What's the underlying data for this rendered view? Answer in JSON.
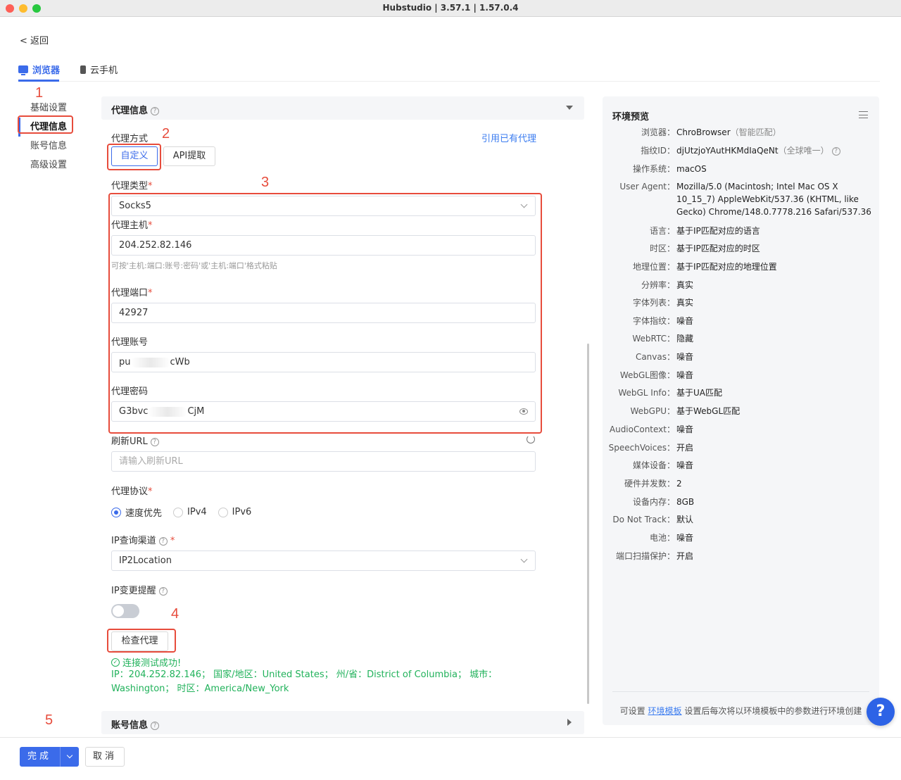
{
  "window": {
    "title": "Hubstudio | 3.57.1 | 1.57.0.4"
  },
  "nav": {
    "back": "< 返回",
    "tabs": [
      {
        "label": "浏览器",
        "icon": "browser-icon"
      },
      {
        "label": "云手机",
        "icon": "phone-icon"
      }
    ],
    "side": [
      "基础设置",
      "代理信息",
      "账号信息",
      "高级设置"
    ]
  },
  "annotations": [
    "1",
    "2",
    "3",
    "4",
    "5"
  ],
  "proxy": {
    "section_title": "代理信息",
    "mode_label": "代理方式",
    "use_existing": "引用已有代理",
    "mode_custom": "自定义",
    "mode_api": "API提取",
    "type_label": "代理类型",
    "type_value": "Socks5",
    "host_label": "代理主机",
    "host_value": "204.252.82.146",
    "host_hint": "可按'主机:端口:账号:密码'或'主机:端口'格式粘贴",
    "port_label": "代理端口",
    "port_value": "42927",
    "account_label": "代理账号",
    "account_prefix": "pu",
    "account_mid": "ibje",
    "account_suffix": "cWb",
    "password_label": "代理密码",
    "password_prefix": "G3bvc",
    "password_suffix": "CjM",
    "refresh_label": "刷新URL",
    "refresh_placeholder": "请输入刷新URL",
    "protocol_label": "代理协议",
    "protocol_options": [
      "速度优先",
      "IPv4",
      "IPv6"
    ],
    "protocol_selected": "速度优先",
    "ipquery_label": "IP查询渠道",
    "ipquery_value": "IP2Location",
    "ipchange_label": "IP变更提醒",
    "ipchange_on": false,
    "check_button": "检查代理",
    "check_result": "连接测试成功!",
    "check_detail": "IP：204.252.82.146；  国家/地区：United States；  州/省：District of Columbia；  城市：Washington；  时区：America/New_York",
    "required_mark": "*"
  },
  "account_section": {
    "title": "账号信息"
  },
  "preview": {
    "title": "环境预览",
    "items": [
      {
        "k": "浏览器：",
        "v": "ChroBrowser",
        "note": "（智能匹配）"
      },
      {
        "k": "指纹ID：",
        "v": "djUtzjoYAutHKMdIaQeNt",
        "note": "（全球唯一）"
      },
      {
        "k": "操作系统：",
        "v": "macOS"
      },
      {
        "k": "User Agent：",
        "v": "Mozilla/5.0 (Macintosh; Intel Mac OS X 10_15_7) AppleWebKit/537.36 (KHTML, like Gecko) Chrome/148.0.7778.216 Safari/537.36"
      },
      {
        "k": "语言：",
        "v": "基于IP匹配对应的语言"
      },
      {
        "k": "时区：",
        "v": "基于IP匹配对应的时区"
      },
      {
        "k": "地理位置：",
        "v": "基于IP匹配对应的地理位置"
      },
      {
        "k": "分辨率：",
        "v": "真实"
      },
      {
        "k": "字体列表：",
        "v": "真实"
      },
      {
        "k": "字体指纹：",
        "v": "噪音"
      },
      {
        "k": "WebRTC：",
        "v": "隐藏"
      },
      {
        "k": "Canvas：",
        "v": "噪音"
      },
      {
        "k": "WebGL图像：",
        "v": "噪音"
      },
      {
        "k": "WebGL Info：",
        "v": "基于UA匹配"
      },
      {
        "k": "WebGPU：",
        "v": "基于WebGL匹配"
      },
      {
        "k": "AudioContext：",
        "v": "噪音"
      },
      {
        "k": "SpeechVoices：",
        "v": "开启"
      },
      {
        "k": "媒体设备：",
        "v": "噪音"
      },
      {
        "k": "硬件并发数：",
        "v": "2"
      },
      {
        "k": "设备内存：",
        "v": "8GB"
      },
      {
        "k": "Do Not Track：",
        "v": "默认"
      },
      {
        "k": "电池：",
        "v": "噪音"
      },
      {
        "k": "端口扫描保护：",
        "v": "开启"
      }
    ],
    "footer_pre": "可设置",
    "footer_link": "环境模板",
    "footer_post": "设置后每次将以环境模板中的参数进行环境创建"
  },
  "help_button": "?",
  "footer": {
    "done": "完成",
    "cancel": "取消"
  },
  "colors": {
    "accent": "#3b6bea",
    "annotation": "#e74c3c",
    "success": "#21b25b"
  }
}
